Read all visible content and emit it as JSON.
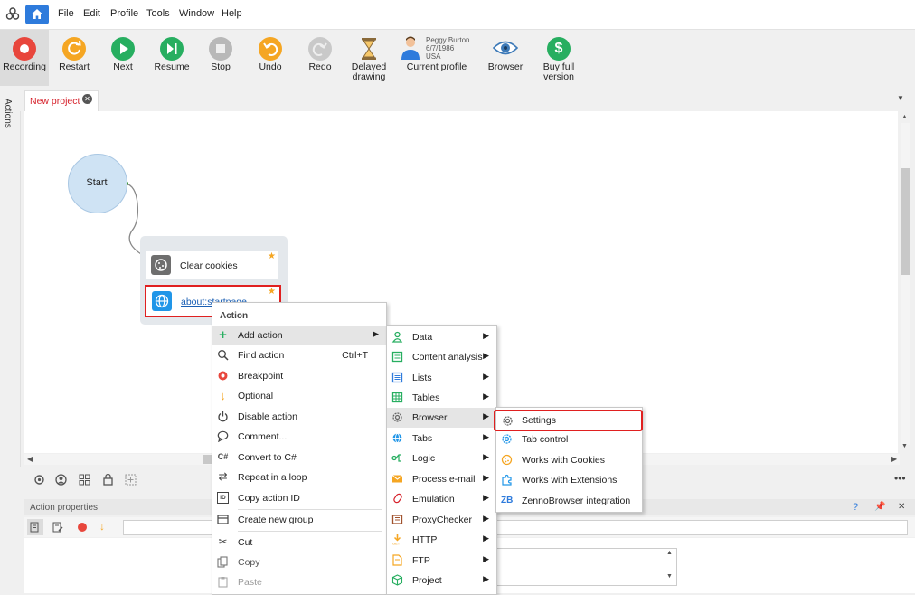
{
  "menubar": {
    "items": [
      "File",
      "Edit",
      "Profile",
      "Tools",
      "Window",
      "Help"
    ]
  },
  "toolbar": {
    "recording": "Recording",
    "restart": "Restart",
    "next": "Next",
    "resume": "Resume",
    "stop": "Stop",
    "undo": "Undo",
    "redo": "Redo",
    "delayed_drawing_1": "Delayed",
    "delayed_drawing_2": "drawing",
    "profile_name": "Peggy Burton",
    "profile_date": "6/7/1986",
    "profile_country": "USA",
    "current_profile": "Current profile",
    "browser": "Browser",
    "buy": "Buy full version",
    "buy_symbol": "$"
  },
  "side": {
    "actions": "Actions"
  },
  "tab": {
    "label": "New project",
    "close": "✕"
  },
  "canvas": {
    "start": "Start",
    "block_clear": "Clear cookies",
    "block_about": "about:startpage"
  },
  "props": {
    "title": "Action properties",
    "help": "?",
    "close": "✕"
  },
  "context_menu": {
    "header": "Action",
    "items": [
      {
        "label": "Add action",
        "shortcut": "",
        "arrow": "▶"
      },
      {
        "label": "Find action",
        "shortcut": "Ctrl+T"
      },
      {
        "label": "Breakpoint"
      },
      {
        "label": "Optional"
      },
      {
        "label": "Disable action"
      },
      {
        "label": "Comment..."
      },
      {
        "label": "Convert to C#",
        "icon": "C#"
      },
      {
        "label": "Repeat in a loop"
      },
      {
        "label": "Copy action ID",
        "icon": "ID"
      },
      {
        "label": "Create new group"
      },
      {
        "label": "Cut"
      },
      {
        "label": "Copy"
      },
      {
        "label": "Paste"
      }
    ]
  },
  "add_action_menu": {
    "items": [
      {
        "label": "Data"
      },
      {
        "label": "Content analysis"
      },
      {
        "label": "Lists"
      },
      {
        "label": "Tables"
      },
      {
        "label": "Browser"
      },
      {
        "label": "Tabs"
      },
      {
        "label": "Logic"
      },
      {
        "label": "Process e-mail"
      },
      {
        "label": "Emulation"
      },
      {
        "label": "ProxyChecker"
      },
      {
        "label": "HTTP"
      },
      {
        "label": "FTP"
      },
      {
        "label": "Project"
      }
    ],
    "arrow": "▶"
  },
  "browser_menu": {
    "items": [
      {
        "label": "Settings"
      },
      {
        "label": "Tab control"
      },
      {
        "label": "Works with Cookies"
      },
      {
        "label": "Works with Extensions"
      },
      {
        "label": "ZennoBrowser integration",
        "icon": "ZB"
      }
    ]
  },
  "colors": {
    "accent": "#2e7bdc",
    "record": "#e8463c",
    "green": "#27ae60",
    "orange": "#f5a623",
    "highlight_red": "#e02020"
  }
}
